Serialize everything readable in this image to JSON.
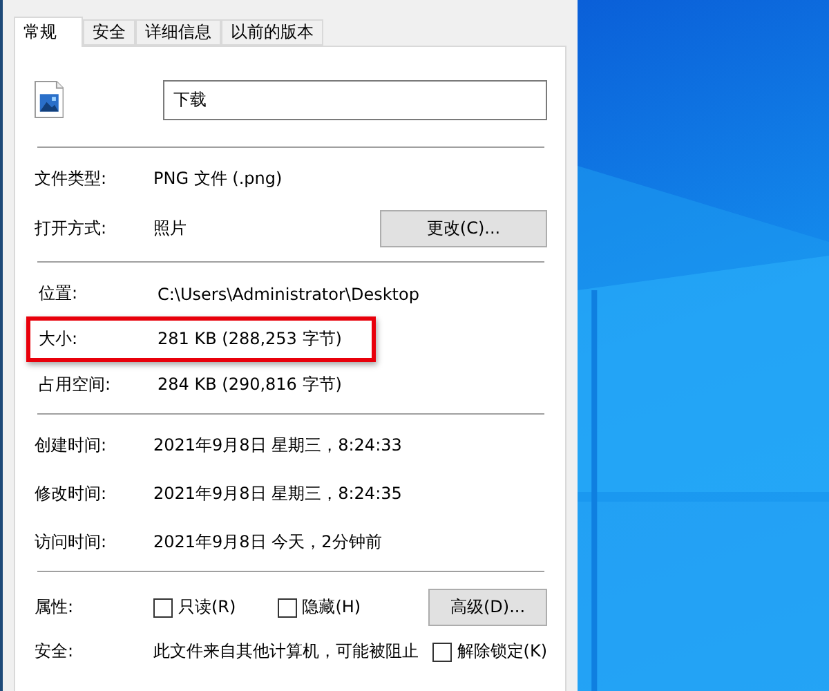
{
  "tabs": [
    {
      "label": "常规",
      "selected": true
    },
    {
      "label": "安全",
      "selected": false
    },
    {
      "label": "详细信息",
      "selected": false
    },
    {
      "label": "以前的版本",
      "selected": false
    }
  ],
  "file_name": {
    "value": "下载"
  },
  "type_section": [
    {
      "label": "文件类型:",
      "value": "PNG 文件 (.png)"
    },
    {
      "label": "打开方式:",
      "value": "照片",
      "button": "更改(C)..."
    }
  ],
  "location_section": [
    {
      "label": "位置:",
      "value": "C:\\Users\\Administrator\\Desktop",
      "highlighted": false
    },
    {
      "label": "大小:",
      "value": "281 KB (288,253 字节)",
      "highlighted": true
    },
    {
      "label": "占用空间:",
      "value": "284 KB (290,816 字节)",
      "highlighted": false
    }
  ],
  "time_section": [
    {
      "label": "创建时间:",
      "value": "2021年9月8日 星期三，8:24:33"
    },
    {
      "label": "修改时间:",
      "value": "2021年9月8日 星期三，8:24:35"
    },
    {
      "label": "访问时间:",
      "value": "2021年9月8日 今天，2分钟前"
    }
  ],
  "attributes": {
    "label": "属性:",
    "options": [
      {
        "label": "只读(R)",
        "checked": false
      },
      {
        "label": "隐藏(H)",
        "checked": false
      }
    ],
    "button": "高级(D)..."
  },
  "security": {
    "label": "安全:",
    "text": "此文件来自其他计算机，可能被阻止",
    "unblock": {
      "label": "解除锁定(K)",
      "checked": false
    }
  }
}
